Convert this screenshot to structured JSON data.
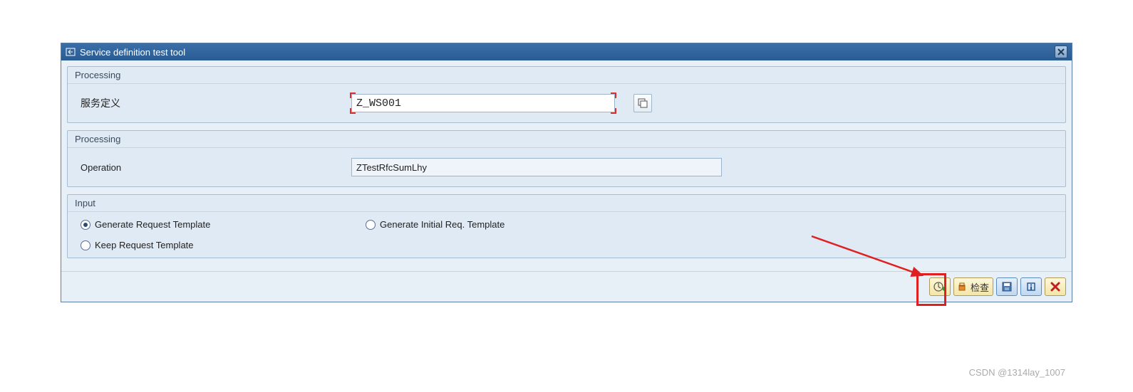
{
  "dialog": {
    "title": "Service definition test tool"
  },
  "group1": {
    "header": "Processing",
    "field_label": "服务定义",
    "field_value": "Z_WS001"
  },
  "group2": {
    "header": "Processing",
    "field_label": "Operation",
    "field_value": "ZTestRfcSumLhy"
  },
  "group3": {
    "header": "Input",
    "radio1": "Generate Request Template",
    "radio2": "Generate Initial Req. Template",
    "radio3": "Keep Request Template",
    "selected": "radio1"
  },
  "toolbar": {
    "check_label": "检查"
  },
  "watermark": "CSDN @1314lay_1007"
}
